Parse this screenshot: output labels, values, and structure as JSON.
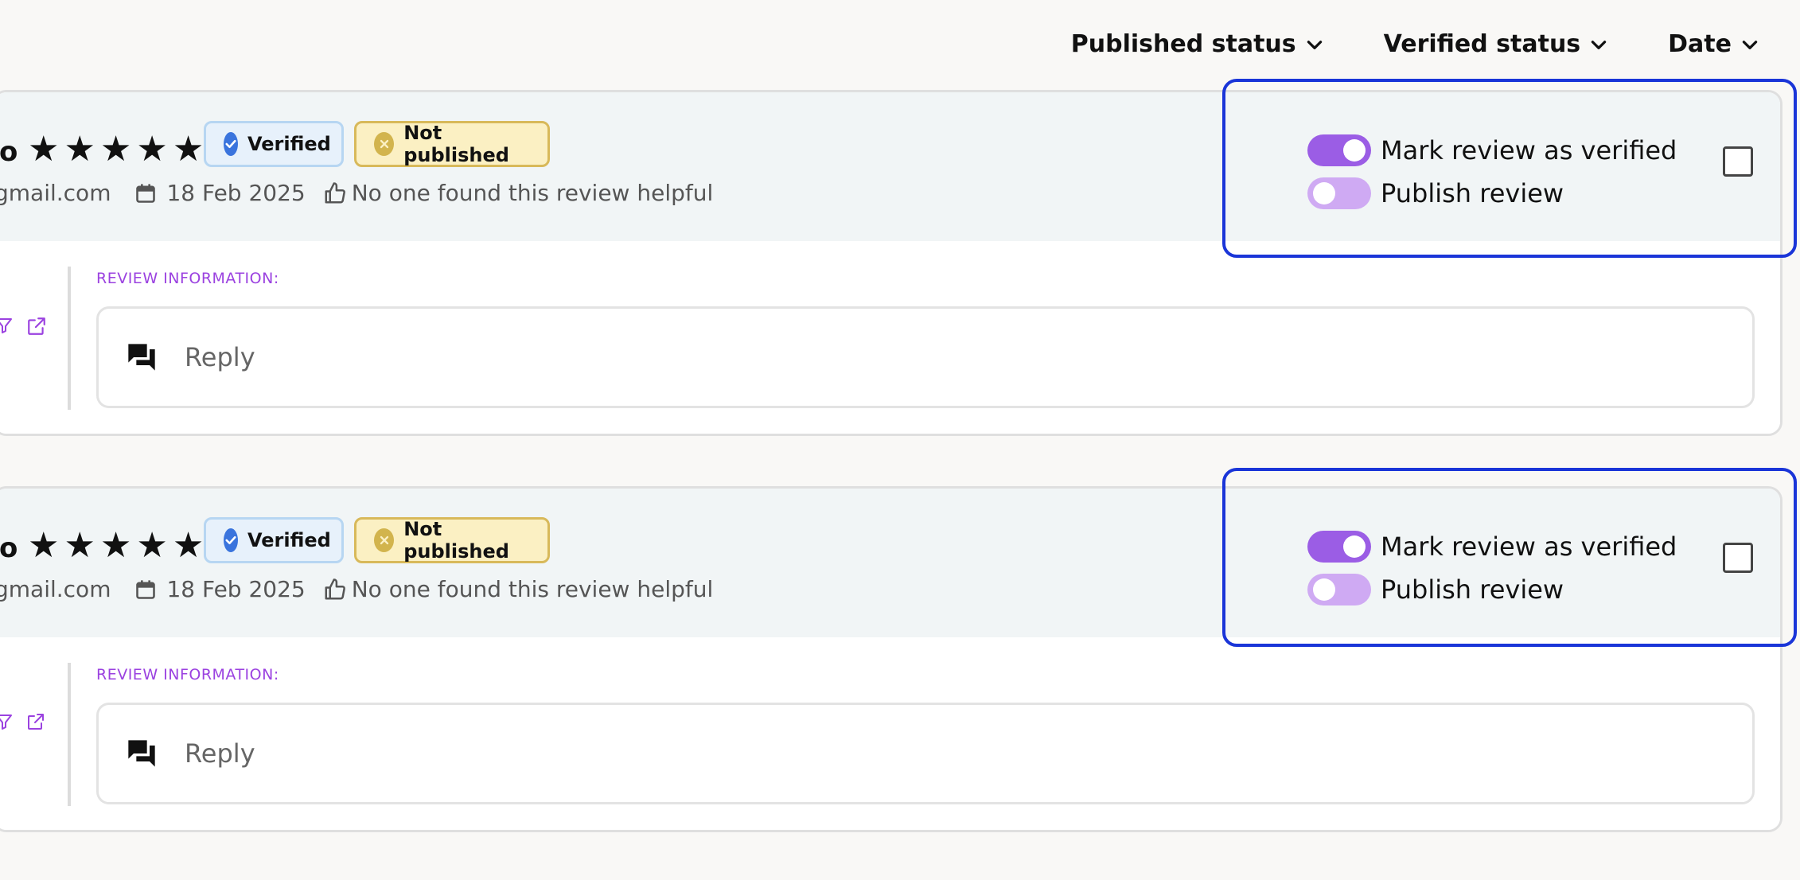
{
  "filters": [
    {
      "label": "Published status"
    },
    {
      "label": "Verified status"
    },
    {
      "label": "Date"
    }
  ],
  "reviews": [
    {
      "name_fragment": "o",
      "stars": [
        "★",
        "★",
        "★",
        "★",
        "★"
      ],
      "badge_verified": "Verified",
      "badge_unpublished": "Not published",
      "email_fragment": "gmail.com",
      "date": "18 Feb 2025",
      "helpful": "No one found this review helpful",
      "toggle_verified_label": "Mark review as verified",
      "toggle_verified_on": true,
      "toggle_publish_label": "Publish review",
      "toggle_publish_on": false,
      "section_label": "REVIEW INFORMATION:",
      "reply_placeholder": "Reply"
    },
    {
      "name_fragment": "o",
      "stars": [
        "★",
        "★",
        "★",
        "★",
        "★"
      ],
      "badge_verified": "Verified",
      "badge_unpublished": "Not published",
      "email_fragment": "gmail.com",
      "date": "18 Feb 2025",
      "helpful": "No one found this review helpful",
      "toggle_verified_label": "Mark review as verified",
      "toggle_verified_on": true,
      "toggle_publish_label": "Publish review",
      "toggle_publish_on": false,
      "section_label": "REVIEW INFORMATION:",
      "reply_placeholder": "Reply"
    }
  ],
  "colors": {
    "accent_purple": "#9b5de5",
    "highlight_blue": "#1a35d8",
    "verified_blue": "#3a74dd",
    "unpublished_yellow": "#d2b44d"
  },
  "icons": [
    "chevron-down-icon",
    "check-circle-icon",
    "x-circle-icon",
    "calendar-icon",
    "thumbs-up-icon",
    "filter-icon",
    "external-link-icon",
    "chat-bubbles-icon"
  ]
}
